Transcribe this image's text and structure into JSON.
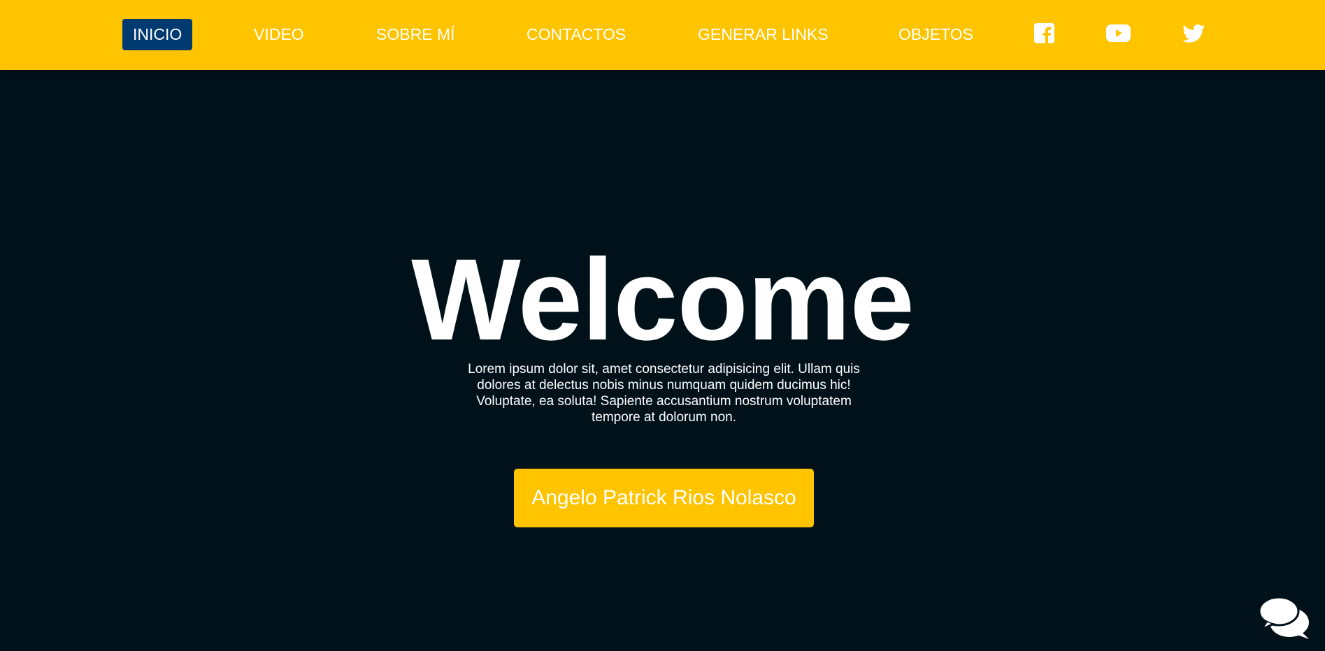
{
  "nav": {
    "items": [
      {
        "label": "INICIO",
        "active": true
      },
      {
        "label": "VIDEO"
      },
      {
        "label": "SOBRE MÍ"
      },
      {
        "label": "CONTACTOS"
      },
      {
        "label": "GENERAR LINKS"
      },
      {
        "label": "OBJETOS"
      }
    ],
    "social_icons": [
      "facebook-icon",
      "youtube-icon",
      "twitter-icon"
    ]
  },
  "hero": {
    "title": "Welcome",
    "text": "Lorem ipsum dolor sit, amet consectetur adipisicing elit. Ullam quis dolores at delectus nobis minus numquam quidem ducimus hic! Voluptate, ea soluta! Sapiente accusantium nostrum voluptatem tempore at dolorum non.",
    "button_label": "Angelo Patrick Rios Nolasco"
  },
  "chat_widget": {
    "icon": "chat-bubbles-icon"
  },
  "colors": {
    "navbar_bg": "#ffc400",
    "active_tab_bg": "#003a70",
    "hero_bg": "#00111a",
    "button_bg": "#ffc400",
    "text": "#ffffff"
  }
}
